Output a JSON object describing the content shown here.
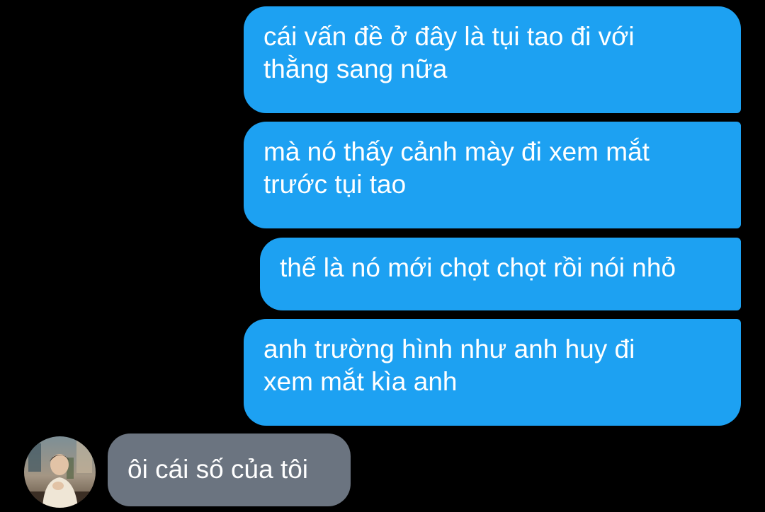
{
  "conversation": {
    "messages": [
      {
        "direction": "outgoing",
        "text": "cái vấn đề ở đây là tụi tao đi với\nthằng sang nữa"
      },
      {
        "direction": "outgoing",
        "text": "mà nó thấy cảnh mày đi xem mắt\ntrước tụi tao"
      },
      {
        "direction": "outgoing",
        "text": "thế là nó mới chọt chọt rồi nói nhỏ"
      },
      {
        "direction": "outgoing",
        "text": "anh trường hình như anh huy đi\nxem mắt kìa anh"
      },
      {
        "direction": "incoming",
        "text": "ôi cái số của tôi"
      }
    ],
    "contact": {
      "avatar_icon": "contact-avatar-photo"
    }
  },
  "theme": {
    "background": "#000000",
    "outgoing_bubble": "#1da1f2",
    "incoming_bubble": "#6b7480",
    "text": "#ffffff"
  }
}
